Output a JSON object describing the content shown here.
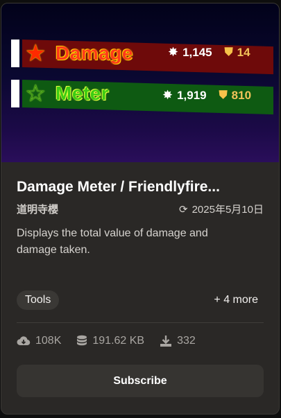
{
  "thumbnail": {
    "banner_top": {
      "star": "★",
      "title": "Damage",
      "stat1": "1,145",
      "stat2": "14"
    },
    "banner_bottom": {
      "star": "☆",
      "title": "Meter",
      "stat1": "1,919",
      "stat2": "810"
    }
  },
  "card": {
    "title": "Damage Meter / Friendlyfire...",
    "author": "道明寺櫻",
    "updated": "2025年5月10日",
    "description": "Displays the total value of damage and damage taken.",
    "tag": "Tools",
    "more_tags": "+ 4 more",
    "stats": {
      "downloads_cloud": "108K",
      "size": "191.62 KB",
      "downloads": "332"
    },
    "subscribe_label": "Subscribe"
  },
  "colors": {
    "card_bg": "#2a2826",
    "button_bg": "#363431",
    "red_band": "#6e0a0a",
    "green_band": "#0e5a12",
    "thumb_bg_top": "#02021a",
    "thumb_bg_bottom": "#2a0e5a"
  }
}
